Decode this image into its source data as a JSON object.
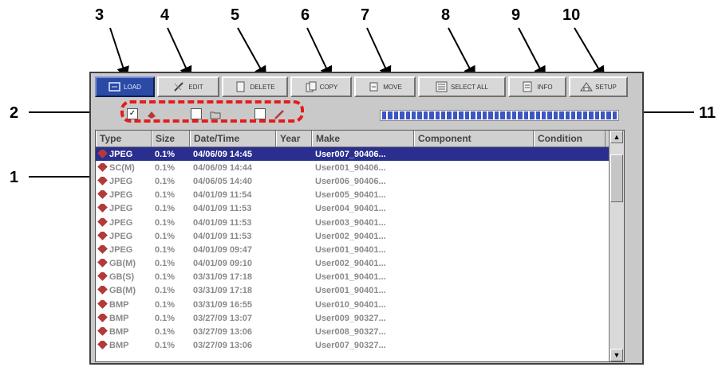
{
  "callouts": [
    "1",
    "2",
    "3",
    "4",
    "5",
    "6",
    "7",
    "8",
    "9",
    "10",
    "11"
  ],
  "toolbar": {
    "buttons": [
      {
        "label": "LOAD",
        "icon": "load-icon"
      },
      {
        "label": "EDIT",
        "icon": "edit-icon"
      },
      {
        "label": "DELETE",
        "icon": "delete-icon"
      },
      {
        "label": "COPY",
        "icon": "copy-icon"
      },
      {
        "label": "MOVE",
        "icon": "move-icon"
      },
      {
        "label": "SELECT ALL",
        "icon": "select-all-icon"
      },
      {
        "label": "INFO",
        "icon": "info-icon"
      },
      {
        "label": "SETUP",
        "icon": "setup-icon"
      }
    ]
  },
  "filters": {
    "items": [
      {
        "checked": true,
        "icon": "image-filter-icon"
      },
      {
        "checked": false,
        "icon": "folder-filter-icon"
      },
      {
        "checked": false,
        "icon": "pencil-filter-icon"
      }
    ],
    "checkmark": "✓"
  },
  "progress": {
    "fraction": 1.0
  },
  "table": {
    "columns": [
      "Type",
      "Size",
      "Date/Time",
      "Year",
      "Make",
      "Component",
      "Condition"
    ],
    "rows": [
      {
        "type": "JPEG",
        "size": "0.1%",
        "date": "04/06/09 14:45",
        "year": "",
        "make": "User007_90406...",
        "selected": true
      },
      {
        "type": "SC(M)",
        "size": "0.1%",
        "date": "04/06/09 14:44",
        "year": "",
        "make": "User001_90406..."
      },
      {
        "type": "JPEG",
        "size": "0.1%",
        "date": "04/06/05 14:40",
        "year": "",
        "make": "User006_90406..."
      },
      {
        "type": "JPEG",
        "size": "0.1%",
        "date": "04/01/09 11:54",
        "year": "",
        "make": "User005_90401..."
      },
      {
        "type": "JPEG",
        "size": "0.1%",
        "date": "04/01/09 11:53",
        "year": "",
        "make": "User004_90401..."
      },
      {
        "type": "JPEG",
        "size": "0.1%",
        "date": "04/01/09 11:53",
        "year": "",
        "make": "User003_90401..."
      },
      {
        "type": "JPEG",
        "size": "0.1%",
        "date": "04/01/09 11:53",
        "year": "",
        "make": "User002_90401..."
      },
      {
        "type": "JPEG",
        "size": "0.1%",
        "date": "04/01/09 09:47",
        "year": "",
        "make": "User001_90401..."
      },
      {
        "type": "GB(M)",
        "size": "0.1%",
        "date": "04/01/09 09:10",
        "year": "",
        "make": "User002_90401..."
      },
      {
        "type": "GB(S)",
        "size": "0.1%",
        "date": "03/31/09 17:18",
        "year": "",
        "make": "User001_90401..."
      },
      {
        "type": "GB(M)",
        "size": "0.1%",
        "date": "03/31/09 17:18",
        "year": "",
        "make": "User001_90401..."
      },
      {
        "type": "BMP",
        "size": "0.1%",
        "date": "03/31/09 16:55",
        "year": "",
        "make": "User010_90401..."
      },
      {
        "type": "BMP",
        "size": "0.1%",
        "date": "03/27/09 13:07",
        "year": "",
        "make": "User009_90327..."
      },
      {
        "type": "BMP",
        "size": "0.1%",
        "date": "03/27/09 13:06",
        "year": "",
        "make": "User008_90327..."
      },
      {
        "type": "BMP",
        "size": "0.1%",
        "date": "03/27/09 13:06",
        "year": "",
        "make": "User007_90327..."
      }
    ]
  },
  "scrollbar": {
    "up": "▲",
    "down": "▼"
  }
}
